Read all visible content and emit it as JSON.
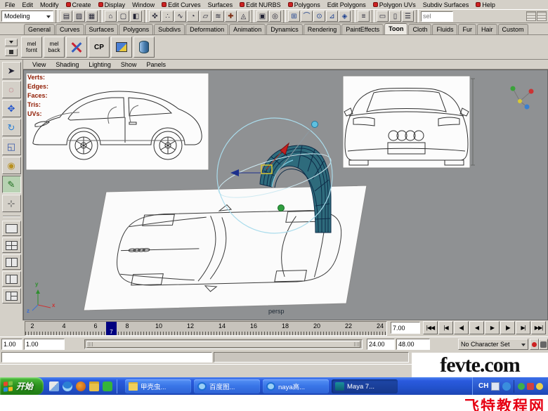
{
  "colors": {
    "ui_face": "#d4d0c8",
    "viewport_bg": "#8f9193",
    "current_frame_block": "#000080",
    "hud_label": "#8f1a00",
    "taskbar_blue": "#2353cf",
    "watermark_red": "#e60012"
  },
  "menu_bar": {
    "items": [
      {
        "label": "File"
      },
      {
        "label": "Edit"
      },
      {
        "label": "Modify"
      },
      {
        "label": "Create"
      },
      {
        "label": "Display"
      },
      {
        "label": "Window"
      },
      {
        "label": "Edit Curves"
      },
      {
        "label": "Surfaces"
      },
      {
        "label": "Edit NURBS"
      },
      {
        "label": "Polygons"
      },
      {
        "label": "Edit Polygons"
      },
      {
        "label": "Polygon UVs"
      },
      {
        "label": "Subdiv Surfaces"
      },
      {
        "label": "Help"
      }
    ]
  },
  "status_line": {
    "mode_selector": "Modeling",
    "quick_select_text": "sel",
    "icons": [
      {
        "name": "new-scene-icon",
        "glyph": "▤"
      },
      {
        "name": "open-scene-icon",
        "glyph": "▨"
      },
      {
        "name": "save-scene-icon",
        "glyph": "▦"
      },
      {
        "name": "select-hierarchy-icon",
        "glyph": "⌂"
      },
      {
        "name": "select-object-icon",
        "glyph": "▢"
      },
      {
        "name": "select-component-icon",
        "glyph": "◧"
      },
      {
        "name": "mask-handles-icon",
        "glyph": "✜"
      },
      {
        "name": "mask-points-icon",
        "glyph": "∴"
      },
      {
        "name": "mask-curves-icon",
        "glyph": "∿"
      },
      {
        "name": "mask-surfaces-icon",
        "glyph": "◔"
      },
      {
        "name": "mask-polygons-icon",
        "glyph": "▱"
      },
      {
        "name": "mask-deformations-icon",
        "glyph": "≋"
      },
      {
        "name": "mask-joints-icon",
        "glyph": "✚"
      },
      {
        "name": "mask-misc-icon",
        "glyph": "◬"
      },
      {
        "name": "lock-selection-icon",
        "glyph": "▣"
      },
      {
        "name": "highlight-selection-icon",
        "glyph": "◎"
      },
      {
        "name": "snap-grid-icon",
        "glyph": "⊞"
      },
      {
        "name": "snap-curve-icon",
        "glyph": "⌒"
      },
      {
        "name": "snap-point-icon",
        "glyph": "⊙"
      },
      {
        "name": "snap-plane-icon",
        "glyph": "⊿"
      },
      {
        "name": "snap-live-icon",
        "glyph": "◈"
      },
      {
        "name": "construction-history-icon",
        "glyph": "≡"
      },
      {
        "name": "render-frame-icon",
        "glyph": "▭"
      },
      {
        "name": "ipr-render-icon",
        "glyph": "▯"
      },
      {
        "name": "render-globals-icon",
        "glyph": "☰"
      }
    ]
  },
  "shelf": {
    "tabs": [
      {
        "label": "General"
      },
      {
        "label": "Curves"
      },
      {
        "label": "Surfaces"
      },
      {
        "label": "Polygons"
      },
      {
        "label": "Subdivs"
      },
      {
        "label": "Deformation"
      },
      {
        "label": "Animation"
      },
      {
        "label": "Dynamics"
      },
      {
        "label": "Rendering"
      },
      {
        "label": "PaintEffects"
      },
      {
        "label": "Toon"
      },
      {
        "label": "Cloth"
      },
      {
        "label": "Fluids"
      },
      {
        "label": "Fur"
      },
      {
        "label": "Hair"
      },
      {
        "label": "Custom"
      }
    ],
    "active_tab": "Toon",
    "items": [
      {
        "line1": "mel",
        "line2": "fornt"
      },
      {
        "line1": "mel",
        "line2": "back"
      }
    ],
    "cp_label": "CP",
    "icon_items": [
      "axis-cross-icon",
      "paint-bucket-icon",
      "cylinder-icon"
    ]
  },
  "toolbox": {
    "tools": [
      {
        "name": "select-tool",
        "glyph": "➤"
      },
      {
        "name": "lasso-tool",
        "glyph": "◌"
      },
      {
        "name": "move-tool",
        "glyph": "✥"
      },
      {
        "name": "rotate-tool",
        "glyph": "↻"
      },
      {
        "name": "scale-tool",
        "glyph": "◱"
      },
      {
        "name": "soft-mod-tool",
        "glyph": "◉"
      },
      {
        "name": "paint-tool",
        "glyph": "✎"
      },
      {
        "name": "show-manipulator-tool",
        "glyph": "⊹"
      }
    ]
  },
  "viewport": {
    "panel_menu": {
      "items": [
        {
          "label": "View"
        },
        {
          "label": "Shading"
        },
        {
          "label": "Lighting"
        },
        {
          "label": "Show"
        },
        {
          "label": "Panels"
        }
      ]
    },
    "hud": {
      "labels": [
        {
          "label": "Verts:"
        },
        {
          "label": "Edges:"
        },
        {
          "label": "Faces:"
        },
        {
          "label": "Tris:"
        },
        {
          "label": "UVs:"
        }
      ]
    },
    "camera_label": "persp",
    "axis": {
      "x": "x",
      "y": "y",
      "z": "z"
    }
  },
  "time_slider": {
    "frame_numbers": [
      "2",
      "4",
      "6",
      "8",
      "10",
      "12",
      "14",
      "16",
      "18",
      "20",
      "22",
      "24"
    ],
    "current_frame": "7",
    "current_time": "7.00",
    "playback": [
      {
        "name": "go-to-start-button",
        "glyph": "|◀◀"
      },
      {
        "name": "step-back-frame-button",
        "glyph": "|◀"
      },
      {
        "name": "step-back-key-button",
        "glyph": "◀|"
      },
      {
        "name": "play-backwards-button",
        "glyph": "◀"
      },
      {
        "name": "play-forwards-button",
        "glyph": "▶"
      },
      {
        "name": "step-forward-key-button",
        "glyph": "|▶"
      },
      {
        "name": "step-forward-frame-button",
        "glyph": "▶|"
      },
      {
        "name": "go-to-end-button",
        "glyph": "▶▶|"
      }
    ]
  },
  "range_slider": {
    "anim_start": "1.00",
    "playback_start": "1.00",
    "playback_end": "24.00",
    "anim_end": "48.00",
    "character_set": "No Character Set"
  },
  "taskbar": {
    "start_label": "开始",
    "tasks": [
      {
        "label": "甲壳虫..."
      },
      {
        "label": "百度图..."
      },
      {
        "label": "naya高..."
      },
      {
        "label": "Maya 7..."
      }
    ],
    "tray_lang": "CH"
  },
  "watermark": {
    "site": "fevte.com",
    "site_cn": "飞特教程网"
  }
}
